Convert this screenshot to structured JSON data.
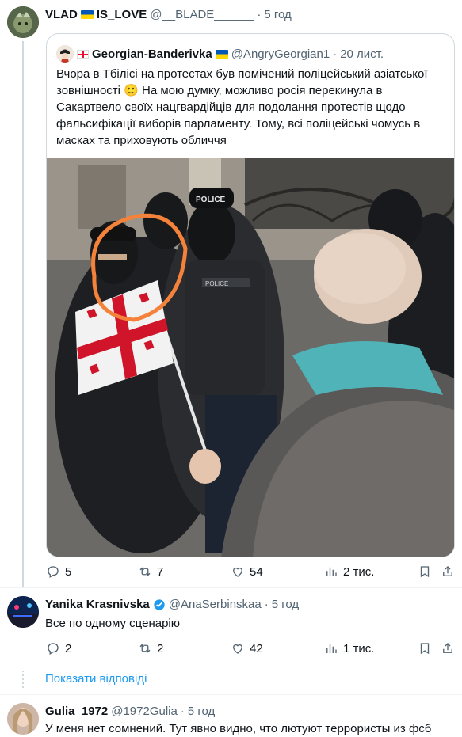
{
  "tweet": {
    "display_name": "VLAD",
    "display_name_suffix": "IS_LOVE",
    "handle": "@__BLADE______",
    "time": "5 год",
    "quoted": {
      "display_name": "Georgian-Banderivka",
      "handle": "@AngryGeorgian1",
      "time": "20 лист.",
      "text": "Вчора в Тбілісі на протестах був помічений поліцейський азіатської зовнішності 🙂 На мою думку, можливо росія перекинула в Сакартвело своїх нацгвардійців для подолання протестів щодо фальсифікації виборів парламенту. Тому, всі поліцейські чомусь в масках та приховують обличчя",
      "photo_labels": {
        "police": "POLICE",
        "police2": "POLICE"
      }
    },
    "stats": {
      "replies": "5",
      "reposts": "7",
      "likes": "54",
      "views": "2 тис."
    }
  },
  "reply1": {
    "display_name": "Yanika Krasnivska",
    "handle": "@AnaSerbinskaa",
    "time": "5 год",
    "text": "Все по одному сценарію",
    "stats": {
      "replies": "2",
      "reposts": "2",
      "likes": "42",
      "views": "1 тис."
    }
  },
  "show_replies_label": "Показати відповіді",
  "reply2": {
    "display_name": "Gulia_1972",
    "handle": "@1972Gulia",
    "time": "5 год",
    "text": "У меня нет сомнений. Тут явно видно, что лютуют террористы из фсб"
  },
  "colors": {
    "accent": "#1d9bf0",
    "muted": "#536471",
    "highlight_circle": "#f4823a"
  }
}
